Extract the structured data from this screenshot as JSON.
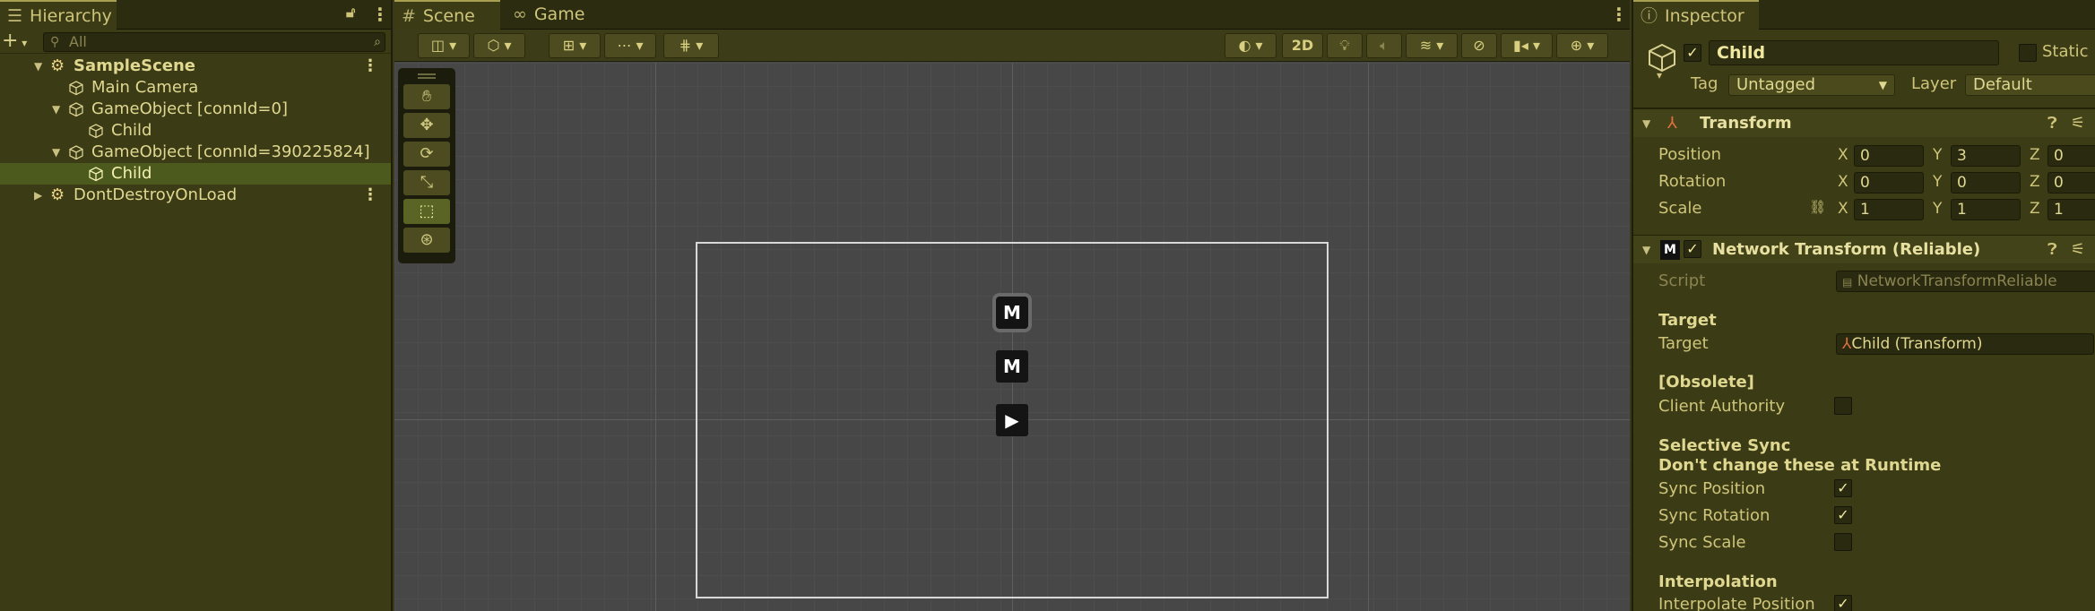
{
  "hierarchy": {
    "tab_label": "Hierarchy",
    "search_placeholder": "All",
    "items": [
      {
        "label": "SampleScene"
      },
      {
        "label": "Main Camera"
      },
      {
        "label": "GameObject [connId=0]"
      },
      {
        "label": "Child"
      },
      {
        "label": "GameObject [connId=390225824]"
      },
      {
        "label": "Child"
      },
      {
        "label": "DontDestroyOnLoad"
      }
    ]
  },
  "scene": {
    "tabs": [
      {
        "label": "Scene"
      },
      {
        "label": "Game"
      }
    ],
    "mode_2d_label": "2D"
  },
  "inspector": {
    "tab_label": "Inspector",
    "object_name": "Child",
    "static_label": "Static",
    "tag_label": "Tag",
    "tag_value": "Untagged",
    "layer_label": "Layer",
    "layer_value": "Default",
    "transform": {
      "title": "Transform",
      "position_label": "Position",
      "rotation_label": "Rotation",
      "scale_label": "Scale",
      "position": {
        "x": "0",
        "y": "3",
        "z": "0"
      },
      "rotation": {
        "x": "0",
        "y": "0",
        "z": "0"
      },
      "scale": {
        "x": "1",
        "y": "1",
        "z": "1"
      },
      "axis_x": "X",
      "axis_y": "Y",
      "axis_z": "Z"
    },
    "network_transform": {
      "title": "Network Transform (Reliable)",
      "script_label": "Script",
      "script_value": "NetworkTransformReliable",
      "target_header": "Target",
      "target_label": "Target",
      "target_value": "Child (Transform)",
      "obsolete_header": "[Obsolete]",
      "client_authority_label": "Client Authority",
      "selective_sync_header": "Selective Sync",
      "selective_sync_note": "Don't change these at Runtime",
      "sync_position_label": "Sync Position",
      "sync_rotation_label": "Sync Rotation",
      "sync_scale_label": "Sync Scale",
      "interpolation_header": "Interpolation",
      "interpolate_position_label": "Interpolate Position"
    }
  },
  "colors": {
    "accent": "#a8a050",
    "selection": "#4d5a1e"
  }
}
